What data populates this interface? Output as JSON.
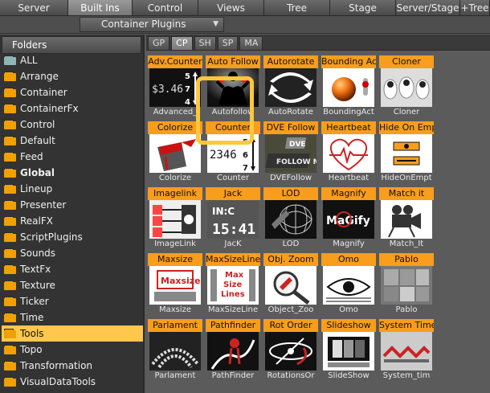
{
  "menu": [
    "Server",
    "Built Ins",
    "Control",
    "Views",
    "Tree",
    "Stage",
    "Server/Stage",
    "+Tree"
  ],
  "subbar": {
    "dropdown_label": "Container Plugins"
  },
  "left": {
    "header": "Folders",
    "items": [
      "ALL",
      "Arrange",
      "Container",
      "ContainerFx",
      "Control",
      "Default",
      "Feed",
      "Global",
      "Lineup",
      "Presenter",
      "RealFX",
      "ScriptPlugins",
      "Sounds",
      "TextFx",
      "Texture",
      "Ticker",
      "Time",
      "Tools",
      "Topo",
      "Transformation",
      "VisualDataTools"
    ]
  },
  "tabs": [
    "GP",
    "CP",
    "SH",
    "SP",
    "MA"
  ],
  "plugins": [
    [
      {
        "title": "Adv.Counter",
        "label": "Advanced_",
        "icon": "advanced-counter-icon"
      },
      {
        "title": "Auto Follow",
        "label": "Autofollow",
        "icon": "autofollow-icon"
      },
      {
        "title": "Autorotate",
        "label": "AutoRotate",
        "icon": "autorotate-icon"
      },
      {
        "title": "Bounding Action",
        "label": "BoundingAct",
        "icon": "bounding-action-icon"
      },
      {
        "title": "Cloner",
        "label": "Cloner",
        "icon": "cloner-icon"
      }
    ],
    [
      {
        "title": "Colorize",
        "label": "Colorize",
        "icon": "colorize-icon"
      },
      {
        "title": "Counter",
        "label": "Counter",
        "icon": "counter-icon"
      },
      {
        "title": "DVE Follow",
        "label": "DVEFollow",
        "icon": "dve-follow-icon"
      },
      {
        "title": "Heartbeat",
        "label": "Heartbeat",
        "icon": "heartbeat-icon"
      },
      {
        "title": "Hide On Empty",
        "label": "HideOnEmpt",
        "icon": "hide-on-empty-icon"
      }
    ],
    [
      {
        "title": "Imagelink",
        "label": "ImageLink",
        "icon": "imagelink-icon"
      },
      {
        "title": "Jack",
        "label": "JacK",
        "icon": "jack-icon"
      },
      {
        "title": "LOD",
        "label": "LOD",
        "icon": "lod-icon"
      },
      {
        "title": "Magnify",
        "label": "Magnify",
        "icon": "magnify-icon"
      },
      {
        "title": "Match it",
        "label": "Match_It",
        "icon": "match-it-icon"
      }
    ],
    [
      {
        "title": "Maxsize",
        "label": "Maxsize",
        "icon": "maxsize-icon"
      },
      {
        "title": "MaxSizeLines",
        "label": "MaxSizeLine",
        "icon": "maxsize-lines-icon"
      },
      {
        "title": "Obj. Zoom",
        "label": "Object_Zoo",
        "icon": "object-zoom-icon"
      },
      {
        "title": "Omo",
        "label": "Omo",
        "icon": "omo-icon"
      },
      {
        "title": "Pablo",
        "label": "Pablo",
        "icon": "pablo-icon"
      }
    ],
    [
      {
        "title": "Parlament",
        "label": "Parlament",
        "icon": "parlament-icon"
      },
      {
        "title": "Pathfinder",
        "label": "PathFinder",
        "icon": "pathfinder-icon"
      },
      {
        "title": "Rot Order",
        "label": "RotationsOr",
        "icon": "rotation-order-icon"
      },
      {
        "title": "Slideshow",
        "label": "SlideShow",
        "icon": "slideshow-icon"
      },
      {
        "title": "System Time",
        "label": "System_tim",
        "icon": "system-time-icon"
      }
    ]
  ],
  "thumb_text": {
    "adv_counter": "$3.46",
    "adv_counter_digits": [
      "5",
      "7",
      "4"
    ],
    "counter": "2346",
    "counter_digits": [
      "5",
      "6",
      "7"
    ],
    "dve": "DVE",
    "follow_me": "FOLLOW ME",
    "jack_top": "IN:C",
    "jack_time": "15:41",
    "maxsize": "Maxsize",
    "max_size_lines": [
      "Max",
      "Size",
      "Lines"
    ],
    "magnify": "MaGify"
  },
  "colors": {
    "accent": "#ffc74d",
    "plugin_title": "#f89d1c"
  }
}
